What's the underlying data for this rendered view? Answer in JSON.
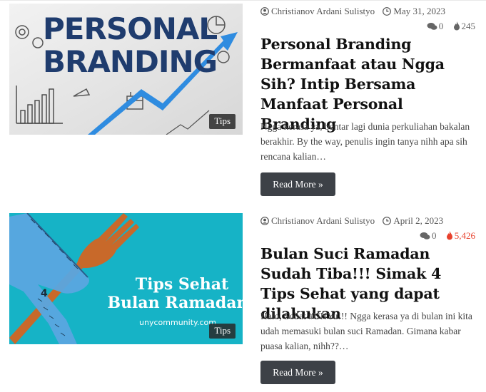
{
  "colors": {
    "button_bg": "#3d4147",
    "hot_views": "#e8412c",
    "tag_bg": "#2a2a2a"
  },
  "posts": [
    {
      "image_alt_text": [
        "PERSONAL",
        "BRANDING"
      ],
      "category_tag": "Tips",
      "author": "Christianov Ardani Sulistyo",
      "date": "May 31, 2023",
      "comments": "0",
      "views": "245",
      "views_hot": false,
      "title": "Personal Branding Bermanfaat atau Ngga Sih? Intip Bersama Manfaat Personal Branding",
      "excerpt": "Ngga kerasa ya, bentar lagi dunia perkuliahan bakalan berakhir. By the way, penulis ingin tanya nihh apa sih rencana kalian…",
      "read_more": "Read More »"
    },
    {
      "image_alt_text": [
        "Tips Sehat",
        "Bulan Ramadan",
        "unycommunity.com"
      ],
      "category_tag": "Tips",
      "author": "Christianov Ardani Sulistyo",
      "date": "April 2, 2023",
      "comments": "0",
      "views": "5,426",
      "views_hot": true,
      "title": "Bulan Suci Ramadan Sudah Tiba!!! Simak 4 Tips Sehat yang dapat dilakukan",
      "excerpt": "Halo, Sobat #UNYu!!! Ngga kerasa ya di bulan ini kita udah memasuki bulan suci Ramadan. Gimana kabar puasa kalian, nihh??…",
      "read_more": "Read More »"
    }
  ],
  "icons": {
    "author": "user-icon",
    "date": "clock-icon",
    "comments": "comments-icon",
    "views": "fire-icon"
  }
}
